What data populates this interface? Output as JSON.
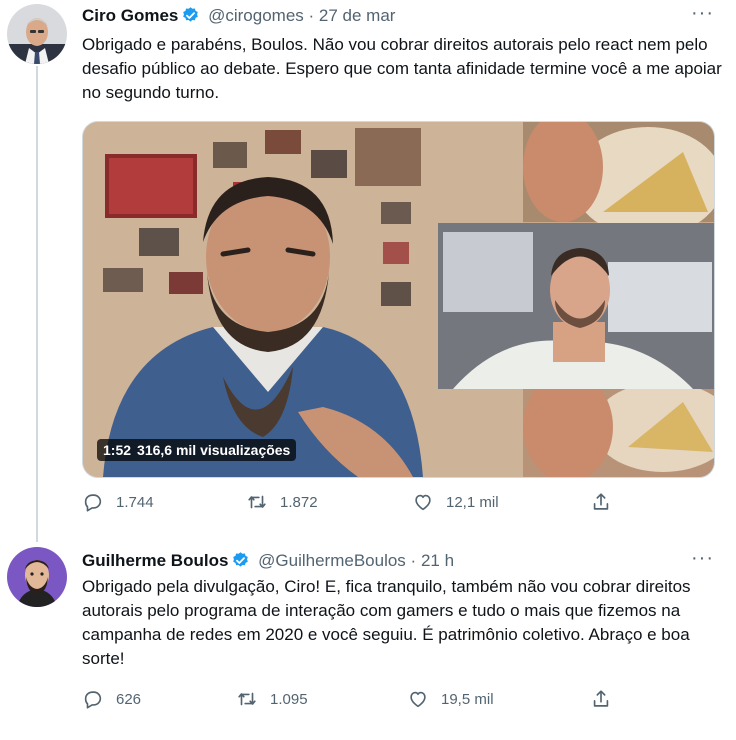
{
  "tweets": [
    {
      "name": "Ciro Gomes",
      "handle": "@cirogomes",
      "separator": "·",
      "time": "27 de mar",
      "more": "···",
      "text": "Obrigado e parabéns, Boulos. Não vou cobrar direitos autorais pelo react nem pelo desafio público ao debate. Espero que com tanta afinidade termine você a me apoiar no segundo turno.",
      "video": {
        "duration": "1:52",
        "views": "316,6 mil visualizações"
      },
      "stats": {
        "replies": "1.744",
        "retweets": "1.872",
        "likes": "12,1 mil"
      },
      "icons": [
        "reply-icon",
        "retweet-icon",
        "like-icon",
        "share-icon"
      ]
    },
    {
      "name": "Guilherme Boulos",
      "handle": "@GuilhermeBoulos",
      "separator": "·",
      "time": "21 h",
      "more": "···",
      "text": "Obrigado pela divulgação, Ciro! E, fica tranquilo, também não vou cobrar direitos autorais pelo programa de interação com gamers e tudo o mais que fizemos na campanha de redes em 2020 e você seguiu. É patrimônio coletivo. Abraço e boa sorte!",
      "stats": {
        "replies": "626",
        "retweets": "1.095",
        "likes": "19,5 mil"
      },
      "icons": [
        "reply-icon",
        "retweet-icon",
        "like-icon",
        "share-icon"
      ]
    }
  ],
  "colors": {
    "verified": "#1d9bf0",
    "muted": "#536471",
    "text": "#0f1419",
    "line": "#cfd9de"
  }
}
